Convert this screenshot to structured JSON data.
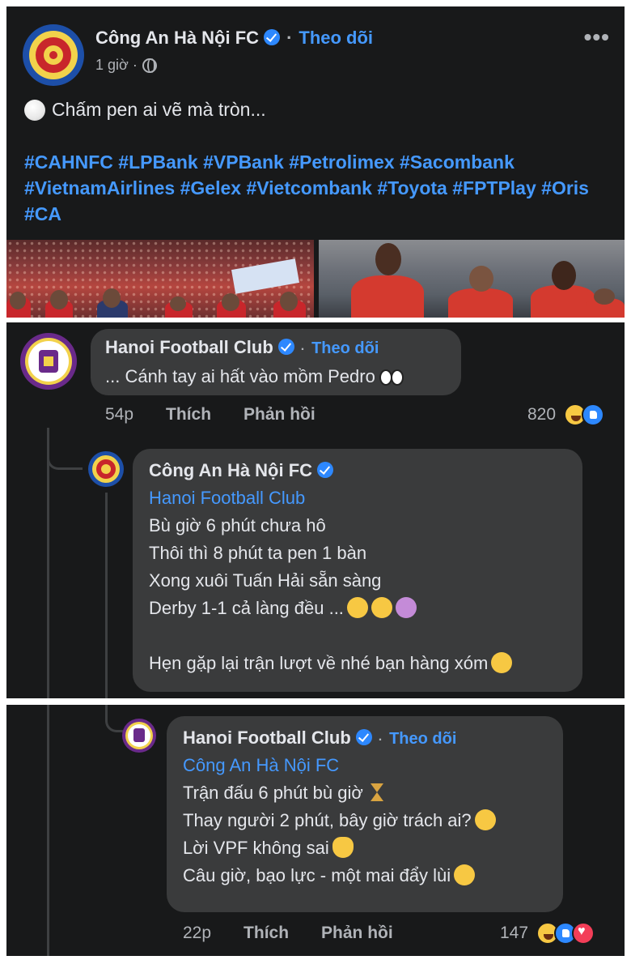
{
  "post": {
    "author": "Công An Hà Nội FC",
    "follow_label": "Theo dõi",
    "dot": "·",
    "time": "1 giờ ·",
    "text": "Chấm pen ai vẽ mà tròn...",
    "hashtags": "#CAHNFC #LPBank #VPBank #Petrolimex #Sacombank #VietnamAirlines #Gelex #Vietcombank #Toyota #FPTPlay #Oris #CA",
    "more_icon": "•••"
  },
  "comment1": {
    "author": "Hanoi Football Club",
    "follow_label": "Theo dõi",
    "text": "... Cánh tay ai hất vào mồm Pedro",
    "time": "54p",
    "like_label": "Thích",
    "reply_label": "Phản hồi",
    "reaction_count": "820"
  },
  "reply1": {
    "author": "Công An Hà Nội FC",
    "mention": "Hanoi Football Club",
    "lines": [
      "Bù giờ 6 phút chưa hô",
      "Thôi thì 8 phút ta pen 1 bàn",
      "Xong xuôi Tuấn Hải sẵn sàng",
      "Derby 1-1 cả làng đều ...",
      "Hẹn gặp lại trận lượt về nhé bạn hàng xóm"
    ]
  },
  "reply2": {
    "author": "Hanoi Football Club",
    "follow_label": "Theo dõi",
    "mention": "Công An Hà Nội FC",
    "lines": [
      "Trận đấu 6 phút bù giờ",
      "Thay người 2 phút, bây giờ trách ai?",
      "Lời VPF không sai",
      "Câu giờ, bạo lực - một mai đẩy lùi"
    ],
    "time": "22p",
    "like_label": "Thích",
    "reply_label": "Phản hồi",
    "reaction_count": "147"
  },
  "colors": {
    "background": "#18191a",
    "bubble": "#3a3b3c",
    "link_blue": "#4599ff",
    "secondary_text": "#b0b3b8"
  }
}
